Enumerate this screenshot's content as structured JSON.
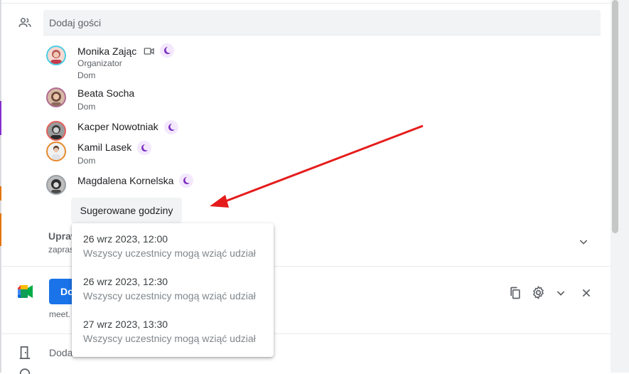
{
  "guests_section": {
    "add_guests_placeholder": "Dodaj gości",
    "guests": [
      {
        "name": "Monika Zając",
        "role": "Organizator",
        "status": "Dom",
        "has_video_icon": true,
        "has_moon_icon": true
      },
      {
        "name": "Beata Socha",
        "status": "Dom",
        "has_moon_icon": false
      },
      {
        "name": "Kacper Nowotniak",
        "has_moon_icon": true
      },
      {
        "name": "Kamil Lasek",
        "status": "Dom",
        "has_moon_icon": true
      },
      {
        "name": "Magdalena Kornelska",
        "has_moon_icon": true
      }
    ],
    "suggest_button": "Sugerowane godziny"
  },
  "permissions": {
    "title": "Upraw",
    "subtitle": "zapras"
  },
  "suggested_times": [
    {
      "time": "26 wrz 2023, 12:00",
      "note": "Wszyscy uczestnicy mogą wziąć udział"
    },
    {
      "time": "26 wrz 2023, 12:30",
      "note": "Wszyscy uczestnicy mogą wziąć udział"
    },
    {
      "time": "27 wrz 2023, 13:30",
      "note": "Wszyscy uczestnicy mogą wziąć udział"
    }
  ],
  "meet": {
    "button_label": "Do",
    "link_text": "meet.",
    "icons": [
      "copy-icon",
      "gear-icon",
      "chevron-down-icon",
      "close-icon"
    ]
  },
  "room": {
    "label": "Doda"
  },
  "colors": {
    "annotation_arrow": "#e51c1c",
    "moon_icon": "#7b2cbf",
    "meet_button": "#1a73e8"
  }
}
